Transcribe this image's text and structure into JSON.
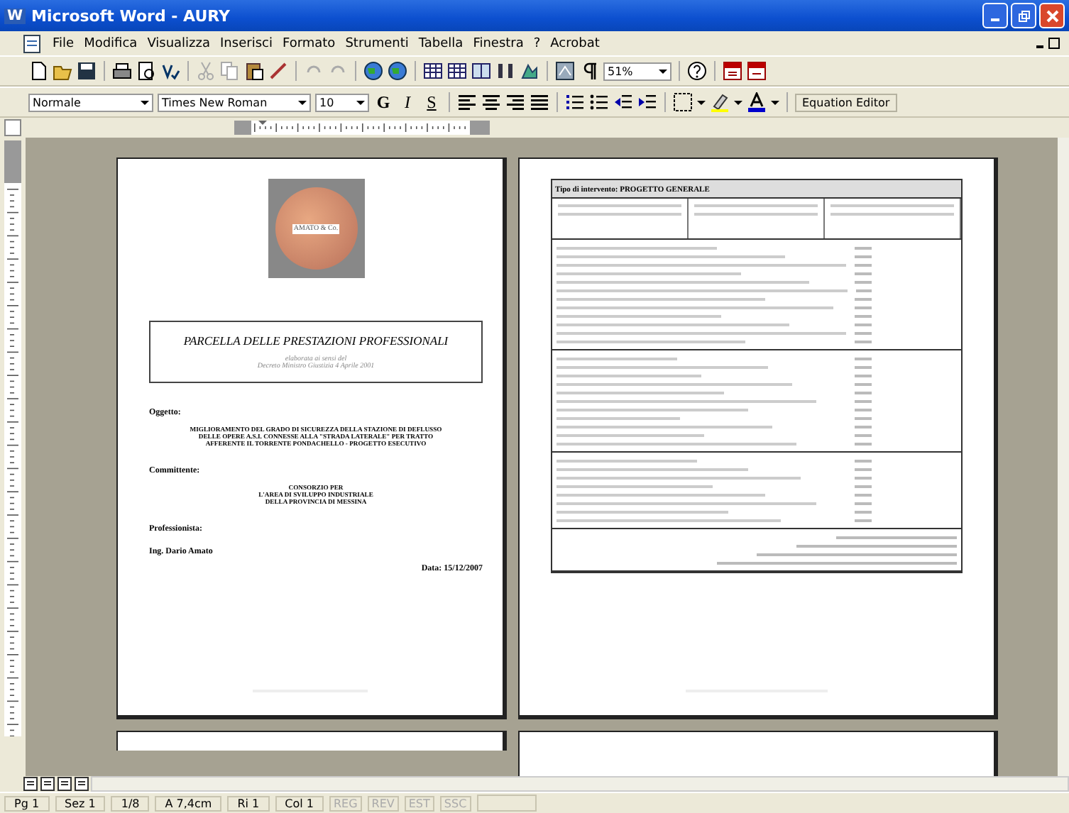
{
  "window": {
    "title": "Microsoft Word - AURY",
    "app_icon": "W"
  },
  "menu": [
    "File",
    "Modifica",
    "Visualizza",
    "Inserisci",
    "Formato",
    "Strumenti",
    "Tabella",
    "Finestra",
    "?",
    "Acrobat"
  ],
  "toolbar": {
    "zoom": "51%"
  },
  "format_bar": {
    "style": "Normale",
    "font": "Times New Roman",
    "size": "10",
    "bold": "G",
    "italic": "I",
    "underline": "S",
    "equation_button": "Equation Editor"
  },
  "left_page": {
    "logo_text": "AMATO & Co.",
    "title": "PARCELLA DELLE PRESTAZIONI PROFESSIONALI",
    "subtitle": [
      "elaborata ai sensi del",
      "Decreto Ministro Giustizia 4 Aprile 2001"
    ],
    "object_label": "Oggetto:",
    "object_text": [
      "MIGLIORAMENTO DEL GRADO DI SICUREZZA DELLA STAZIONE DI DEFLUSSO",
      "DELLE OPERE A.S.I. CONNESSE ALLA \"STRADA LATERALE\" PER TRATTO",
      "AFFERENTE IL TORRENTE PONDACHELLO - PROGETTO ESECUTIVO"
    ],
    "client_label": "Committente:",
    "client_text": [
      "CONSORZIO PER",
      "L'AREA DI SVILUPPO INDUSTRIALE",
      "DELLA PROVINCIA DI MESSINA"
    ],
    "professional_label": "Professionista:",
    "professional_name": "Ing. Dario Amato",
    "date": "Data: 15/12/2007"
  },
  "right_page": {
    "heading": "Tipo di intervento: PROGETTO GENERALE"
  },
  "status_bar": [
    "Pg 1",
    "Sez 1",
    "1/8",
    "A 7,4cm",
    "Ri 1",
    "Col 1"
  ],
  "status_modes": [
    {
      "label": "REG",
      "on": false
    },
    {
      "label": "REV",
      "on": false
    },
    {
      "label": "EST",
      "on": false
    },
    {
      "label": "SSC",
      "on": false
    }
  ]
}
